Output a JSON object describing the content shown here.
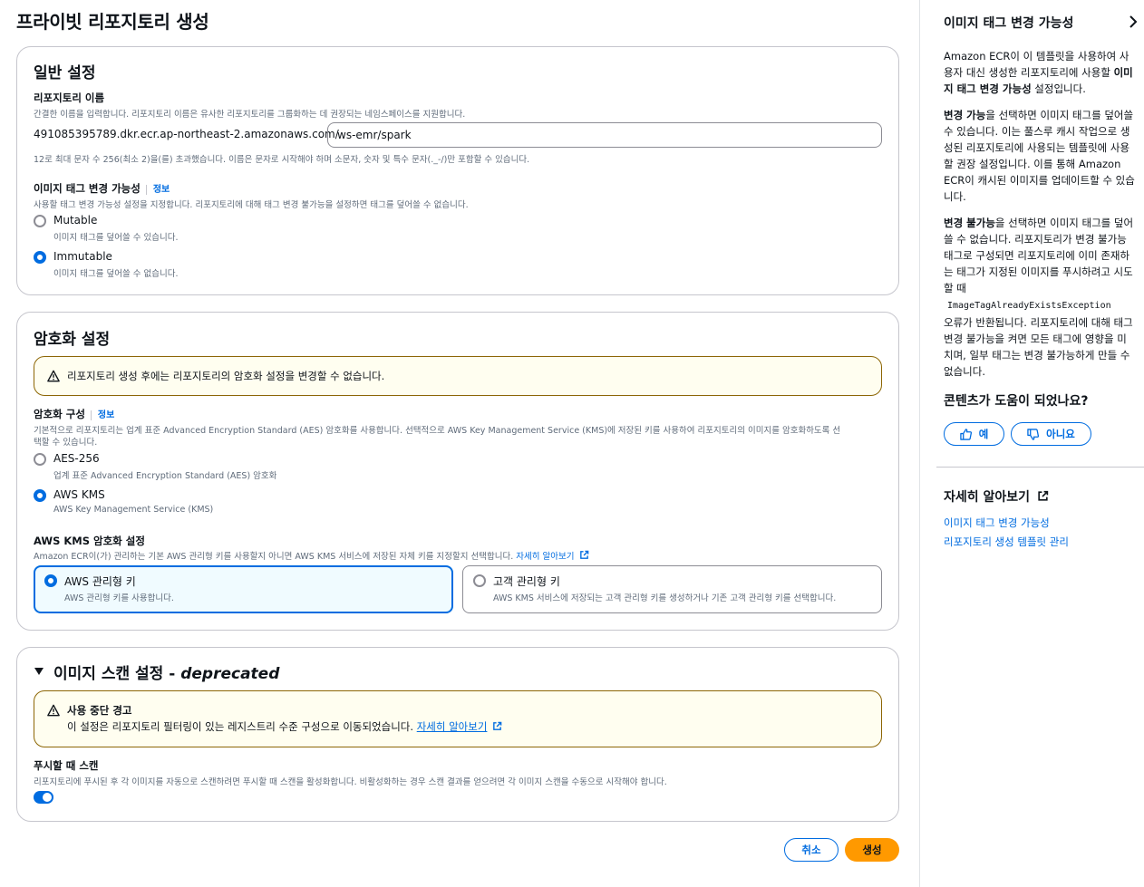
{
  "page": {
    "title": "프라이빗 리포지토리 생성"
  },
  "general": {
    "title": "일반 설정",
    "repo_name_label": "리포지토리 이름",
    "repo_name_desc": "간결한 이름을 입력합니다. 리포지토리 이름은 유사한 리포지토리를 그룹화하는 데 권장되는 네임스페이스를 지원합니다.",
    "registry_prefix": "491085395789.dkr.ecr.ap-northeast-2.amazonaws.com/",
    "repo_name_value": "ws-emr/spark",
    "repo_name_hint": "12로 최대 문자 수 256(최소 2)을(를) 초과했습니다. 이름은 문자로 시작해야 하며 소문자, 숫자 및 특수 문자(._-/)만 포함할 수 있습니다.",
    "mutability_label": "이미지 태그 변경 가능성",
    "info": "정보",
    "mutability_desc": "사용할 태그 변경 가능성 설정을 지정합니다. 리포지토리에 대해 태그 변경 불가능을 설정하면 태그를 덮어쓸 수 없습니다.",
    "mutable_label": "Mutable",
    "mutable_desc": "이미지 태그를 덮어쓸 수 있습니다.",
    "immutable_label": "Immutable",
    "immutable_desc": "이미지 태그를 덮어쓸 수 없습니다."
  },
  "encryption": {
    "title": "암호화 설정",
    "alert": "리포지토리 생성 후에는 리포지토리의 암호화 설정을 변경할 수 없습니다.",
    "config_label": "암호화 구성",
    "info": "정보",
    "config_desc_1": "기본적으로 리포지토리는 업계 표준 Advanced Encryption Standard (AES) 암호화를 사용합니다. 선택적으로 AWS Key Management Service (KMS)에 저장된 키를 사용하여 리포지토리의 이미지를 암호화하도록 선",
    "config_desc_2": "택할 수 있습니다.",
    "aes_label": "AES-256",
    "aes_desc": "업계 표준 Advanced Encryption Standard (AES) 암호화",
    "kms_label": "AWS KMS",
    "kms_desc": "AWS Key Management Service (KMS)",
    "kms_settings_label": "AWS KMS 암호화 설정",
    "kms_settings_desc": "Amazon ECR이(가) 관리하는 기본 AWS 관리형 키를 사용할지 아니면 AWS KMS 서비스에 저장된 자체 키를 지정할지 선택합니다.",
    "learn_more": "자세히 알아보기",
    "aws_managed_label": "AWS 관리형 키",
    "aws_managed_desc": "AWS 관리형 키를 사용합니다.",
    "customer_label": "고객 관리형 키",
    "customer_desc": "AWS KMS 서비스에 저장되는 고객 관리형 키를 생성하거나 기존 고객 관리형 키를 선택합니다."
  },
  "scan": {
    "title": "이미지 스캔 설정 - ",
    "title_em": "deprecated",
    "alert_title": "사용 중단 경고",
    "alert_text": "이 설정은 리포지토리 필터링이 있는 레지스트리 수준 구성으로 이동되었습니다.",
    "learn_more": "자세히 알아보기",
    "push_label": "푸시할 때 스캔",
    "push_desc": "리포지토리에 푸시된 후 각 이미지를 자동으로 스캔하려면 푸시할 때 스캔을 활성화합니다. 비활성화하는 경우 스캔 결과를 얻으려면 각 이미지 스캔을 수동으로 시작해야 합니다."
  },
  "actions": {
    "cancel": "취소",
    "create": "생성"
  },
  "side": {
    "title": "이미지 태그 변경 가능성",
    "p1_a": "Amazon ECR이 이 템플릿을 사용하여 사용자 대신 생성한 리포지토리에 사용할 ",
    "p1_b": "이미지 태그 변경 가능성",
    "p1_c": " 설정입니다.",
    "p2_a": "변경 가능",
    "p2_b": "을 선택하면 이미지 태그를 덮어쓸 수 있습니다. 이는 풀스루 캐시 작업으로 생성된 리포지토리에 사용되는 템플릿에 사용할 권장 설정입니다. 이를 통해 Amazon ECR이 캐시된 이미지를 업데이트할 수 있습니다.",
    "p3_a": "변경 불가능",
    "p3_b": "을 선택하면 이미지 태그를 덮어쓸 수 없습니다. 리포지토리가 변경 불가능 태그로 구성되면 리포지토리에 이미 존재하는 태그가 지정된 이미지를 푸시하려고 시도할 때",
    "p3_code": "ImageTagAlreadyExistsException",
    "p3_c": "오류가 반환됩니다. 리포지토리에 대해 태그 변경 불가능을 켜면 모든 태그에 영향을 미치며, 일부 태그는 변경 불가능하게 만들 수 없습니다.",
    "feedback_title": "콘텐츠가 도움이 되었나요?",
    "yes": "예",
    "no": "아니요",
    "learn_title": "자세히 알아보기",
    "link1": "이미지 태그 변경 가능성",
    "link2": "리포지토리 생성 템플릿 관리"
  },
  "colors": {
    "primary": "#006ce0",
    "create_button": "#ff9900",
    "warning_bg": "#fffef0",
    "warning_border": "#8d6605"
  }
}
